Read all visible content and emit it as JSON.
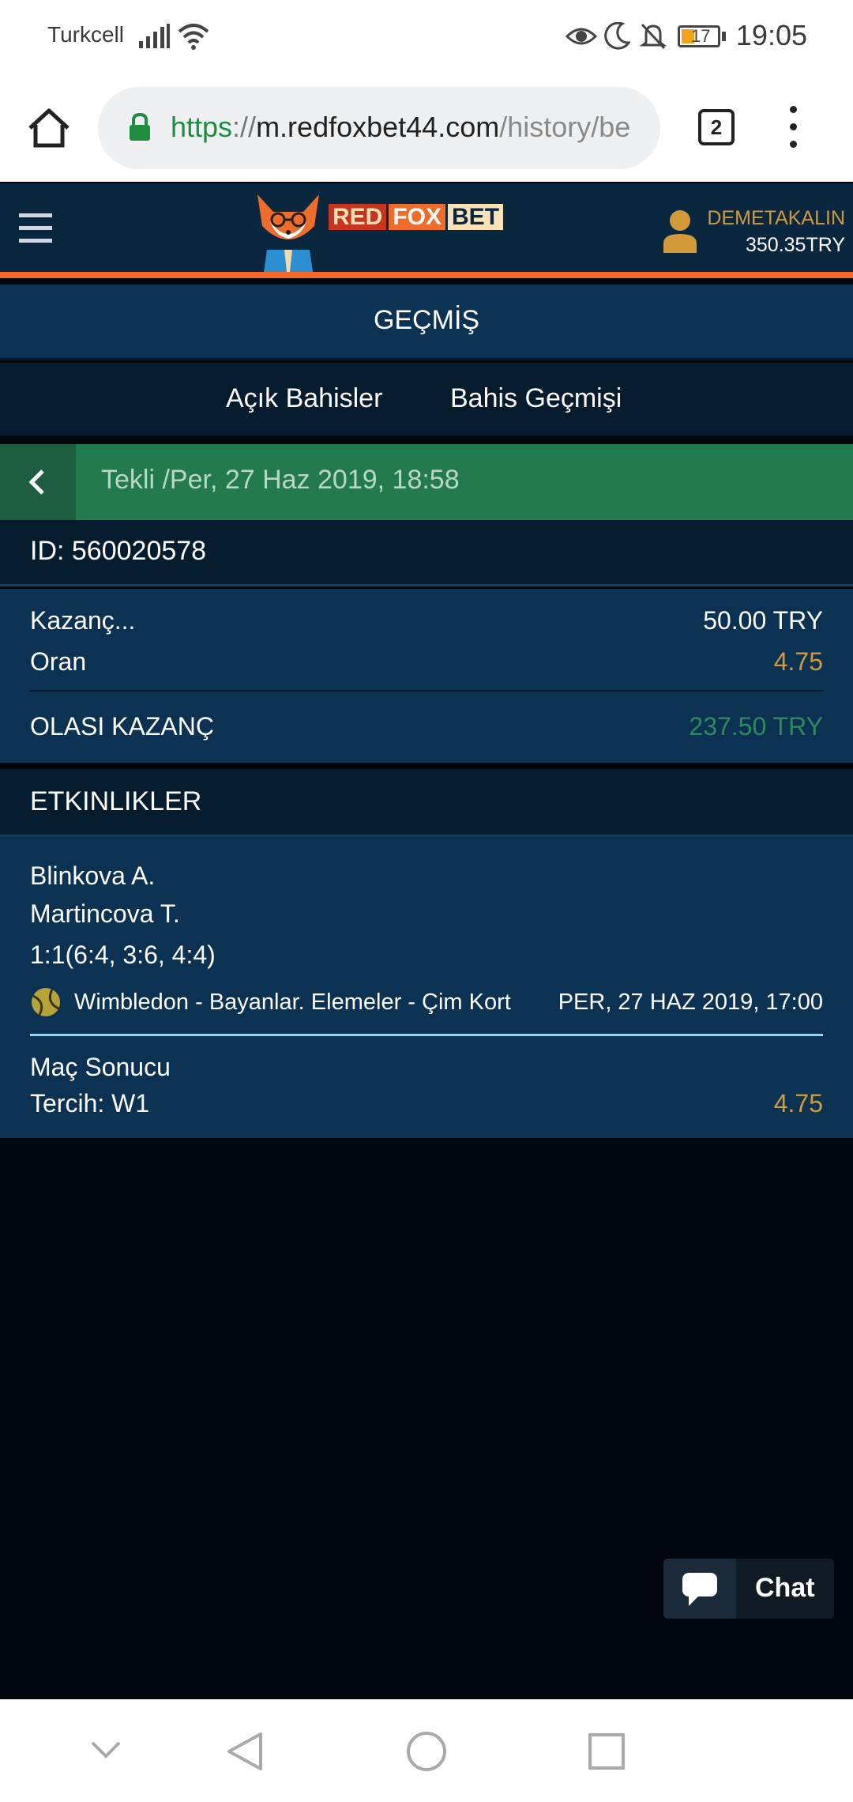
{
  "status_bar": {
    "carrier": "Turkcell",
    "battery": "17",
    "time": "19:05"
  },
  "browser": {
    "url_scheme": "https",
    "url_separator": "://",
    "url_host": "m.redfoxbet44.com",
    "url_path": "/history/be",
    "tab_count": "2"
  },
  "site": {
    "logo": {
      "part1": "RED",
      "part2": "FOX",
      "part3": "BET"
    },
    "user": {
      "name": "DEMETAKALIN",
      "balance": "350.35TRY"
    }
  },
  "page": {
    "title": "GEÇMİŞ",
    "tabs": [
      "Açık Bahisler",
      "Bahis Geçmişi"
    ]
  },
  "bet": {
    "header": "Tekli /Per, 27 Haz 2019, 18:58",
    "id_text": "ID: 560020578",
    "stake_label": "Kazanç...",
    "stake_value": "50.00 TRY",
    "odds_label": "Oran",
    "odds_value": "4.75",
    "potential_label": "OLASI KAZANÇ",
    "potential_value": "237.50 TRY"
  },
  "events": {
    "heading": "ETKINLIKLER",
    "items": [
      {
        "team1": "Blinkova A.",
        "team2": "Martincova T.",
        "score": "1:1(6:4, 3:6, 4:4)",
        "competition": "Wimbledon - Bayanlar. Elemeler - Çim Kort",
        "datetime": "PER, 27 HAZ 2019, 17:00",
        "market": "Maç Sonucu",
        "selection": "Tercih: W1",
        "odds": "4.75"
      }
    ]
  },
  "chat": {
    "label": "Chat"
  },
  "colors": {
    "accent_orange": "#f4692a",
    "header_navy": "#0a2740",
    "green_bar": "#237a4f",
    "odds_gold": "#d29a38",
    "potential_green": "#2d8a5a"
  }
}
